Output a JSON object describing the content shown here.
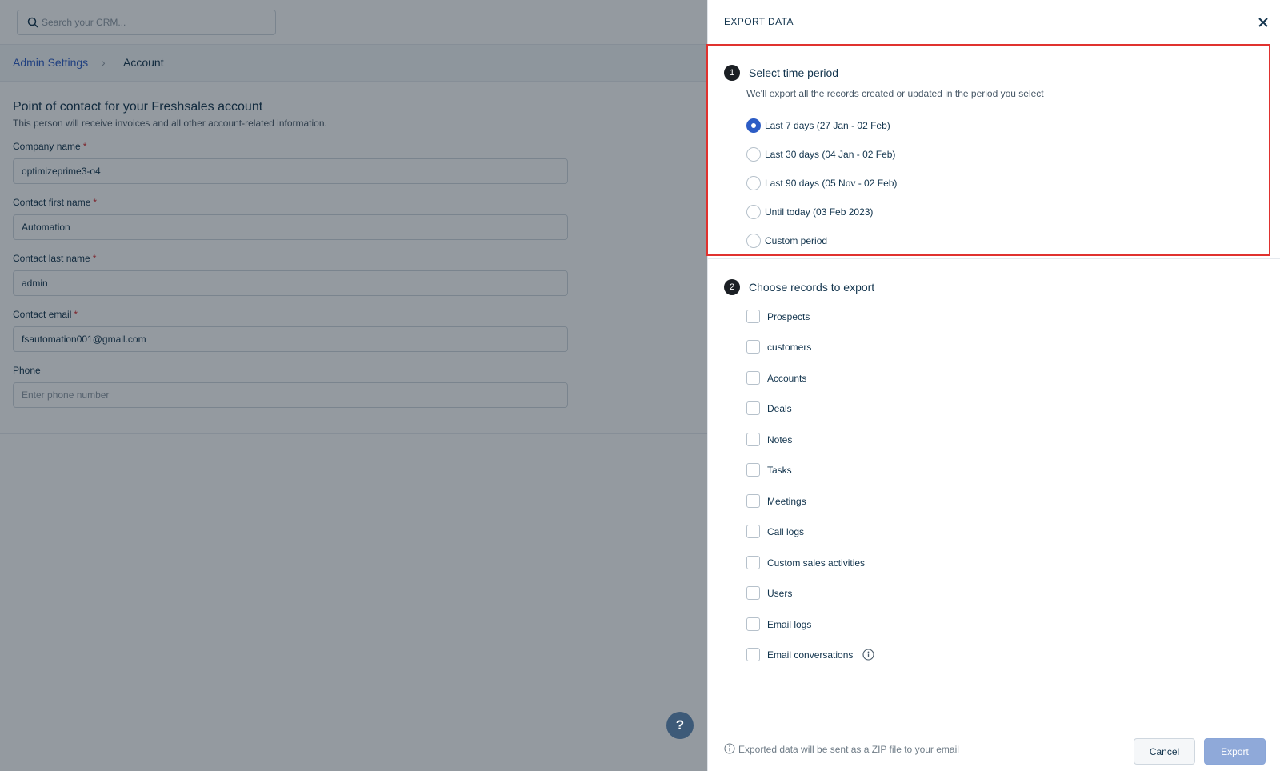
{
  "background": {
    "search": {
      "placeholder": "Search your CRM..."
    },
    "breadcrumb": {
      "parent": "Admin Settings",
      "separator": "›",
      "current": "Account"
    },
    "form": {
      "title": "Point of contact for your Freshsales account",
      "subtitle": "This person will receive invoices and all other account-related information.",
      "fields": [
        {
          "label": "Company name",
          "required": true,
          "value": "optimizeprime3-o4",
          "placeholder": ""
        },
        {
          "label": "Contact first name",
          "required": true,
          "value": "Automation",
          "placeholder": ""
        },
        {
          "label": "Contact last name",
          "required": true,
          "value": "admin",
          "placeholder": ""
        },
        {
          "label": "Contact email",
          "required": true,
          "value": "fsautomation001@gmail.com",
          "placeholder": ""
        },
        {
          "label": "Phone",
          "required": false,
          "value": "",
          "placeholder": "Enter phone number"
        }
      ],
      "required_mark": "*"
    },
    "help_button": "?"
  },
  "drawer": {
    "title": "EXPORT DATA",
    "step1": {
      "number": "1",
      "title": "Select time period",
      "description": "We'll export all the records created or updated in the period you select",
      "options": [
        {
          "label": "Last 7 days (27 Jan - 02 Feb)",
          "selected": true
        },
        {
          "label": "Last 30 days (04 Jan - 02 Feb)",
          "selected": false
        },
        {
          "label": "Last 90 days (05 Nov - 02 Feb)",
          "selected": false
        },
        {
          "label": "Until today (03 Feb 2023)",
          "selected": false
        },
        {
          "label": "Custom period",
          "selected": false
        }
      ]
    },
    "step2": {
      "number": "2",
      "title": "Choose records to export",
      "records": [
        {
          "label": "Prospects",
          "checked": false
        },
        {
          "label": "customers",
          "checked": false
        },
        {
          "label": "Accounts",
          "checked": false
        },
        {
          "label": "Deals",
          "checked": false
        },
        {
          "label": "Notes",
          "checked": false
        },
        {
          "label": "Tasks",
          "checked": false
        },
        {
          "label": "Meetings",
          "checked": false
        },
        {
          "label": "Call logs",
          "checked": false
        },
        {
          "label": "Custom sales activities",
          "checked": false
        },
        {
          "label": "Users",
          "checked": false
        },
        {
          "label": "Email logs",
          "checked": false
        },
        {
          "label": "Email conversations",
          "checked": false,
          "has_info_icon": true
        }
      ]
    },
    "footer": {
      "note": "Exported data will be sent as a ZIP file to your email",
      "cancel_label": "Cancel",
      "export_label": "Export"
    }
  },
  "colors": {
    "accent": "#2c5cc5",
    "highlight_border": "#e0322f",
    "export_button_disabled": "#8fa9d9",
    "required": "#d72d30"
  }
}
